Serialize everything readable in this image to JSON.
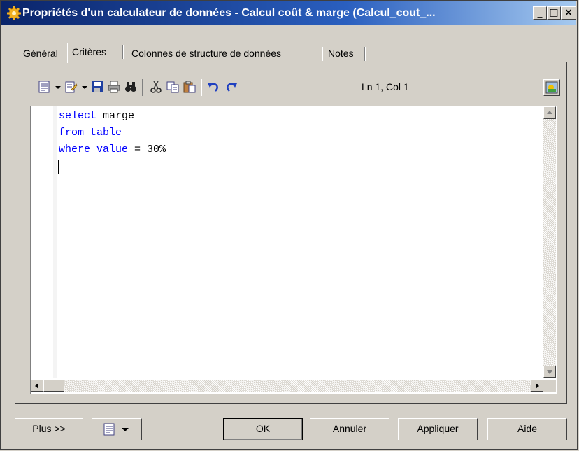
{
  "window": {
    "title": "Propriétés d'un calculateur de données - Calcul coût & marge (Calcul_cout_...",
    "minimize_label": "_",
    "maximize_label": "□",
    "close_label": "×"
  },
  "tabs": [
    {
      "label": "Général",
      "active": false
    },
    {
      "label": "Critères",
      "active": true
    },
    {
      "label": "Colonnes de structure de données",
      "active": false
    },
    {
      "label": "Notes",
      "active": false
    }
  ],
  "toolbar": {
    "icons": [
      "edit-menu-icon",
      "edit-with-icon",
      "save-icon",
      "print-icon",
      "find-icon",
      "cut-icon",
      "copy-icon",
      "paste-icon",
      "undo-icon",
      "redo-icon",
      "properties-icon"
    ],
    "cursor_position": "Ln 1, Col 1"
  },
  "editor": {
    "lines": [
      {
        "keyword": "select",
        "rest": " marge"
      },
      {
        "keyword": "from table",
        "rest": ""
      },
      {
        "keyword": "where value",
        "rest": " = 30%"
      }
    ]
  },
  "buttons": {
    "more": "Plus >>",
    "ok": "OK",
    "cancel": "Annuler",
    "apply_mnemonic": "A",
    "apply_rest": "ppliquer",
    "help": "Aide"
  },
  "colors": {
    "keyword": "#0000ff",
    "title_bar": "#0a246a",
    "dialog": "#d4d0c8"
  }
}
